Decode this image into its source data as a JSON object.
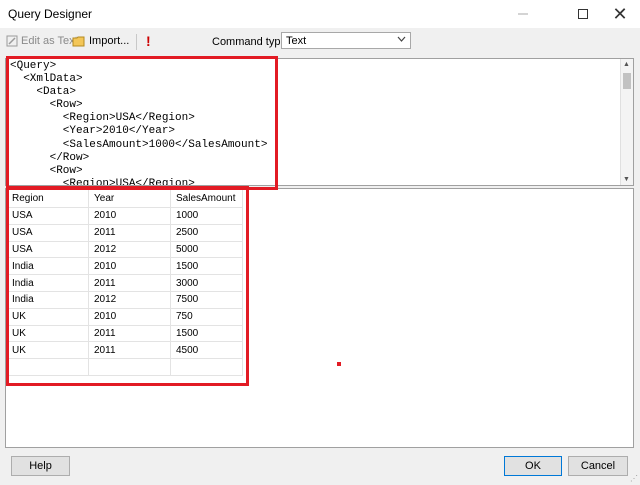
{
  "window": {
    "title": "Query Designer",
    "close_glyph": "✕"
  },
  "toolbar": {
    "edit_as_text": "Edit as Text",
    "import": "Import...",
    "run_glyph": "!",
    "command_type_label": "Command type:",
    "command_type_value": "Text"
  },
  "query": {
    "lines": [
      "<Query>",
      "  <XmlData>",
      "    <Data>",
      "      <Row>",
      "        <Region>USA</Region>",
      "        <Year>2010</Year>",
      "        <SalesAmount>1000</SalesAmount>",
      "      </Row>",
      "      <Row>",
      "        <Region>USA</Region>"
    ]
  },
  "results": {
    "headers": [
      "Region",
      "Year",
      "SalesAmount"
    ],
    "rows": [
      [
        "USA",
        "2010",
        "1000"
      ],
      [
        "USA",
        "2011",
        "2500"
      ],
      [
        "USA",
        "2012",
        "5000"
      ],
      [
        "India",
        "2010",
        "1500"
      ],
      [
        "India",
        "2011",
        "3000"
      ],
      [
        "India",
        "2012",
        "7500"
      ],
      [
        "UK",
        "2010",
        "750"
      ],
      [
        "UK",
        "2011",
        "1500"
      ],
      [
        "UK",
        "2011",
        "4500"
      ],
      [
        "",
        "",
        ""
      ]
    ]
  },
  "buttons": {
    "help": "Help",
    "ok": "OK",
    "cancel": "Cancel"
  },
  "colors": {
    "highlight": "#e21b24",
    "run_icon": "#cc0000",
    "ok_border": "#0078d7"
  }
}
